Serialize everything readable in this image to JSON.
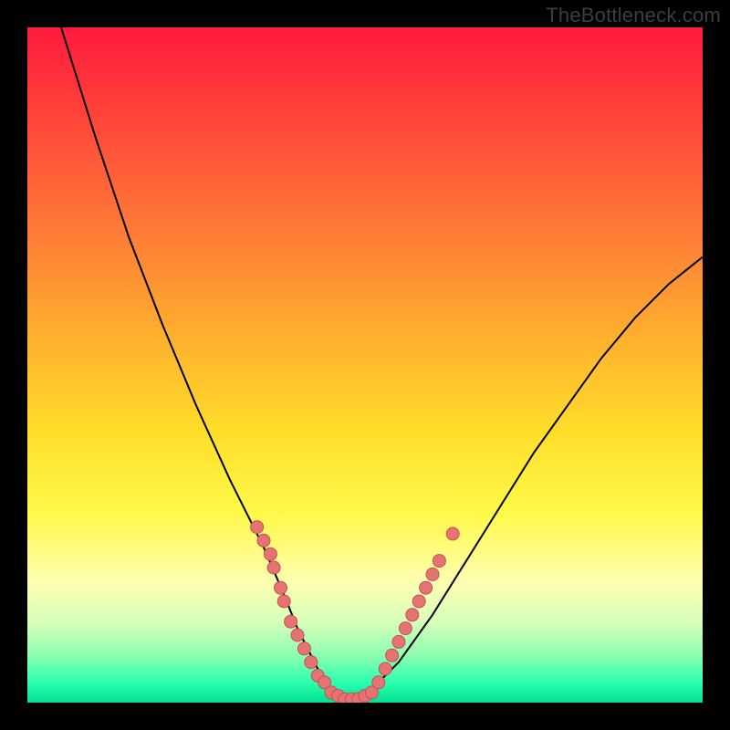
{
  "watermark": "TheBottleneck.com",
  "colors": {
    "frame": "#000000",
    "gradient_top": "#ff1a3c",
    "gradient_bottom": "#00e090",
    "curve": "#000000",
    "dot_fill": "#e57373",
    "dot_stroke": "#c84f4f"
  },
  "chart_data": {
    "type": "line",
    "title": "",
    "xlabel": "",
    "ylabel": "",
    "xlim": [
      0,
      100
    ],
    "ylim": [
      0,
      100
    ],
    "grid": false,
    "notes": "V-shaped bottleneck curve; y approximates percentage bottleneck (0 = good/green at bottom, 100 = bad/red at top). Background is a vertical red-to-green gradient. Scatter points cluster along the lower V near the minimum.",
    "series": [
      {
        "name": "bottleneck-curve",
        "x": [
          5,
          10,
          15,
          20,
          25,
          30,
          35,
          38,
          40,
          42,
          44,
          46,
          48,
          50,
          55,
          60,
          65,
          70,
          75,
          80,
          85,
          90,
          95,
          100
        ],
        "y": [
          100,
          84,
          69,
          56,
          44,
          33,
          23,
          16,
          11,
          7,
          3,
          1,
          0,
          1,
          6,
          13,
          21,
          29,
          37,
          44,
          51,
          57,
          62,
          66
        ]
      }
    ],
    "scatter": [
      {
        "name": "left-cluster",
        "points": [
          {
            "x": 34,
            "y": 26
          },
          {
            "x": 35,
            "y": 24
          },
          {
            "x": 36,
            "y": 22
          },
          {
            "x": 36.5,
            "y": 20
          },
          {
            "x": 37.5,
            "y": 17
          },
          {
            "x": 38,
            "y": 15
          },
          {
            "x": 39,
            "y": 12
          },
          {
            "x": 40,
            "y": 10
          },
          {
            "x": 41,
            "y": 8
          },
          {
            "x": 42,
            "y": 6
          },
          {
            "x": 43,
            "y": 4
          },
          {
            "x": 44,
            "y": 3
          }
        ]
      },
      {
        "name": "bottom-cluster",
        "points": [
          {
            "x": 45,
            "y": 1.5
          },
          {
            "x": 46,
            "y": 1
          },
          {
            "x": 47,
            "y": 0.5
          },
          {
            "x": 48,
            "y": 0.5
          },
          {
            "x": 49,
            "y": 0.5
          },
          {
            "x": 50,
            "y": 1
          },
          {
            "x": 51,
            "y": 1.5
          }
        ]
      },
      {
        "name": "right-cluster",
        "points": [
          {
            "x": 52,
            "y": 3
          },
          {
            "x": 53,
            "y": 5
          },
          {
            "x": 54,
            "y": 7
          },
          {
            "x": 55,
            "y": 9
          },
          {
            "x": 56,
            "y": 11
          },
          {
            "x": 57,
            "y": 13
          },
          {
            "x": 58,
            "y": 15
          },
          {
            "x": 59,
            "y": 17
          },
          {
            "x": 60,
            "y": 19
          },
          {
            "x": 61,
            "y": 21
          },
          {
            "x": 63,
            "y": 25
          }
        ]
      }
    ]
  }
}
